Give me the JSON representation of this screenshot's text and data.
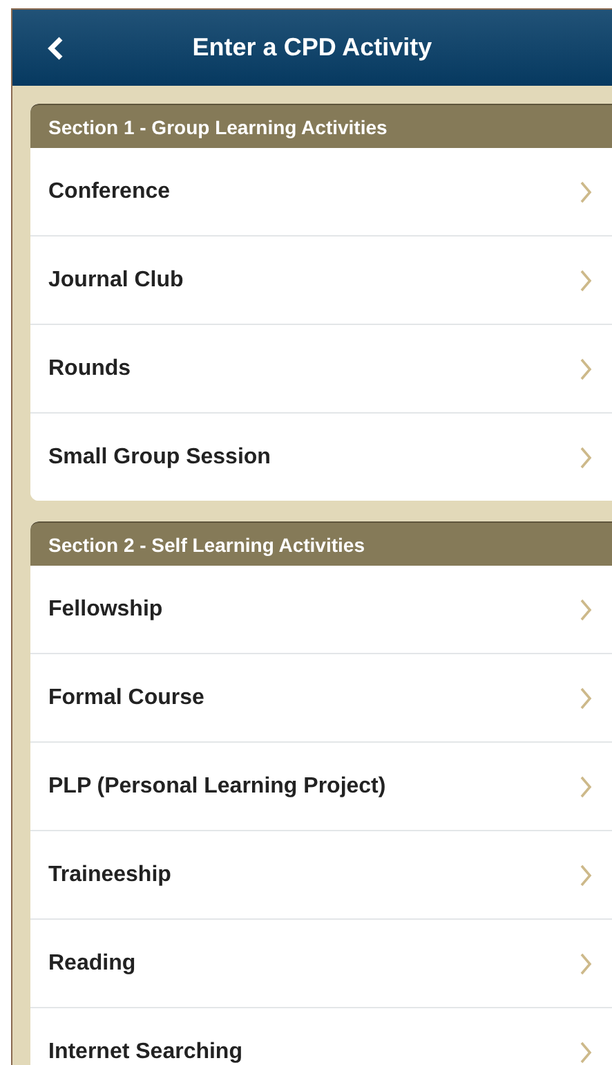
{
  "header": {
    "title": "Enter a CPD Activity"
  },
  "sections": [
    {
      "title": "Section 1 - Group Learning Activities",
      "items": [
        {
          "label": "Conference"
        },
        {
          "label": "Journal Club"
        },
        {
          "label": "Rounds"
        },
        {
          "label": "Small Group Session"
        }
      ]
    },
    {
      "title": "Section 2 - Self Learning Activities",
      "items": [
        {
          "label": "Fellowship"
        },
        {
          "label": "Formal Course"
        },
        {
          "label": "PLP (Personal Learning Project)"
        },
        {
          "label": "Traineeship"
        },
        {
          "label": "Reading"
        },
        {
          "label": "Internet Searching"
        }
      ]
    }
  ]
}
